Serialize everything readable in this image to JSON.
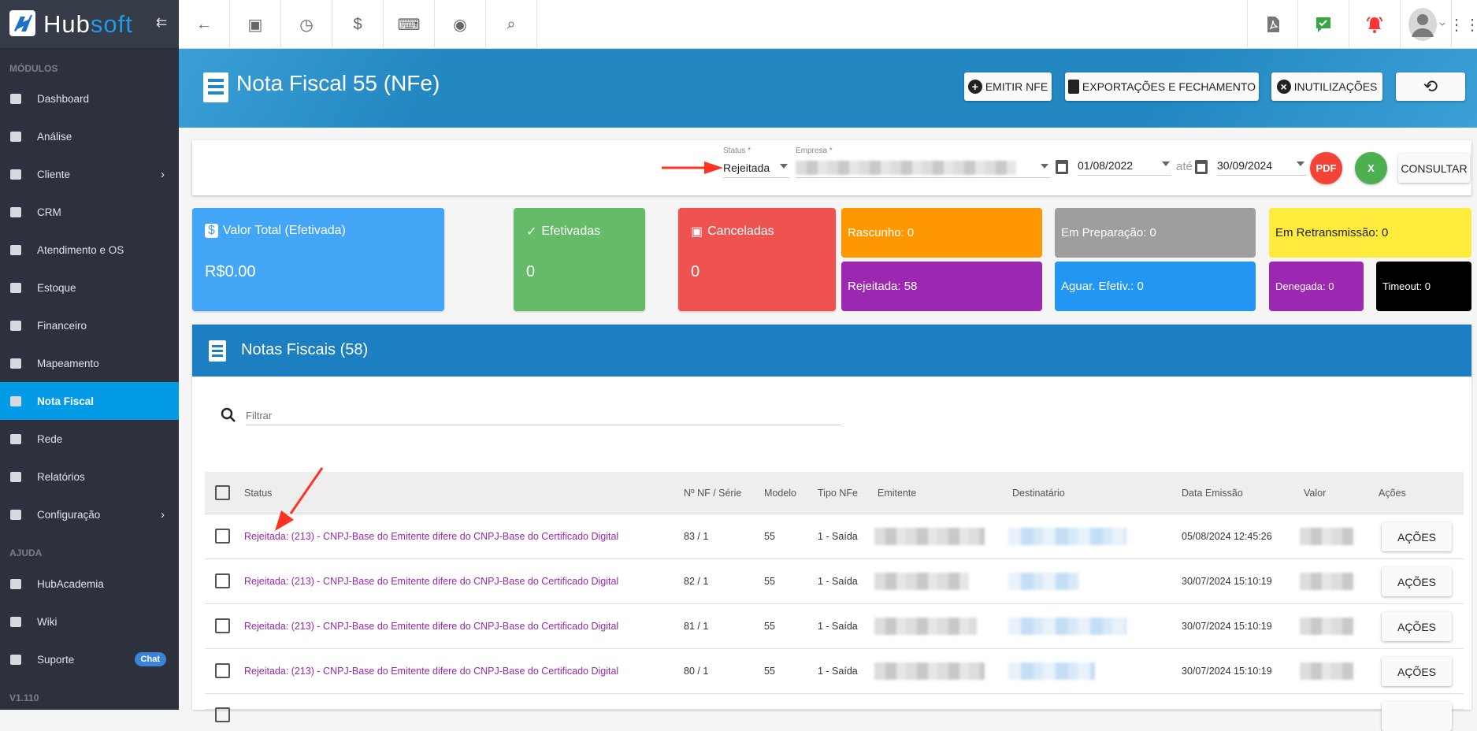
{
  "app": {
    "logo_text_a": "Hub",
    "logo_text_b": "soft",
    "version": "V1.110"
  },
  "sidebar": {
    "section_modules": "MÓDULOS",
    "section_help": "AJUDA",
    "items": [
      {
        "label": "Dashboard",
        "icon": "dashboard-icon"
      },
      {
        "label": "Análise",
        "icon": "pie-chart-icon"
      },
      {
        "label": "Cliente",
        "icon": "contact-icon",
        "chevron": true
      },
      {
        "label": "CRM",
        "icon": "trello-icon"
      },
      {
        "label": "Atendimento e OS",
        "icon": "calendar-clock-icon"
      },
      {
        "label": "Estoque",
        "icon": "box-icon"
      },
      {
        "label": "Financeiro",
        "icon": "money-icon"
      },
      {
        "label": "Mapeamento",
        "icon": "map-marker-icon"
      },
      {
        "label": "Nota Fiscal",
        "icon": "receipt-icon",
        "active": true
      },
      {
        "label": "Rede",
        "icon": "server-icon"
      },
      {
        "label": "Relatórios",
        "icon": "file-icon"
      },
      {
        "label": "Configuração",
        "icon": "gear-icon",
        "chevron": true
      }
    ],
    "help_items": [
      {
        "label": "HubAcademia",
        "icon": "youtube-icon"
      },
      {
        "label": "Wiki",
        "icon": "wikipedia-icon"
      },
      {
        "label": "Suporte",
        "icon": "message-icon",
        "badge": "Chat"
      }
    ]
  },
  "topbar": {
    "icons": [
      "arrow-left-icon",
      "contact-icon",
      "calendar-clock-icon",
      "dollar-icon",
      "terminal-icon",
      "eye-icon",
      "search-icon"
    ],
    "right_icons": [
      "pdf-icon",
      "chat-check-icon",
      "bell-icon",
      "avatar",
      "grid-icon"
    ]
  },
  "header": {
    "title": "Nota Fiscal 55 (NFe)",
    "buttons": {
      "emit": "EMITIR NFE",
      "export": "EXPORTAÇÕES E FECHAMENTO",
      "inutil": "INUTILIZAÇÕES"
    }
  },
  "filters": {
    "status_label": "Status *",
    "status_value": "Rejeitada",
    "empresa_label": "Empresa *",
    "date_from": "01/08/2022",
    "until": "até",
    "date_to": "30/09/2024",
    "consult": "CONSULTAR"
  },
  "stats": {
    "valor_label": "Valor Total (Efetivada)",
    "valor": "R$0.00",
    "efetivadas_label": "Efetivadas",
    "efetivadas": "0",
    "canceladas_label": "Canceladas",
    "canceladas": "0",
    "rascunho": "Rascunho: 0",
    "rejeitada": "Rejeitada: 58",
    "preparacao": "Em Preparação: 0",
    "aguar": "Aguar. Efetiv.: 0",
    "retransmissao": "Em Retransmissão: 0",
    "denegada": "Denegada: 0",
    "timeout": "Timeout: 0"
  },
  "colors": {
    "sidebar": "#2d313d",
    "active": "#039be5",
    "valor": "#42a5f5",
    "efetivadas": "#66bb6a",
    "canceladas": "#ef5350",
    "rascunho": "#ff9800",
    "rejeitada": "#9c27b0",
    "preparacao": "#9e9e9e",
    "aguar": "#2196f3",
    "retransmissao": "#ffeb3b",
    "timeout": "#000000"
  },
  "list": {
    "title": "Notas Fiscais (58)",
    "filter_placeholder": "Filtrar",
    "columns": [
      "Status",
      "Nº NF / Série",
      "Modelo",
      "Tipo NFe",
      "Emitente",
      "Destinatário",
      "Data Emissão",
      "Valor",
      "Ações"
    ],
    "rows": [
      {
        "status": "Rejeitada: (213) - CNPJ-Base do Emitente difere do CNPJ-Base do Certificado Digital",
        "nf": "83 / 1",
        "modelo": "55",
        "tipo": "1 - Saída",
        "data": "05/08/2024 12:45:26",
        "acao": "AÇÕES"
      },
      {
        "status": "Rejeitada: (213) - CNPJ-Base do Emitente difere do CNPJ-Base do Certificado Digital",
        "nf": "82 / 1",
        "modelo": "55",
        "tipo": "1 - Saída",
        "data": "30/07/2024 15:10:19",
        "acao": "AÇÕES"
      },
      {
        "status": "Rejeitada: (213) - CNPJ-Base do Emitente difere do CNPJ-Base do Certificado Digital",
        "nf": "81 / 1",
        "modelo": "55",
        "tipo": "1 - Saída",
        "data": "30/07/2024 15:10:19",
        "acao": "AÇÕES"
      },
      {
        "status": "Rejeitada: (213) - CNPJ-Base do Emitente difere do CNPJ-Base do Certificado Digital",
        "nf": "80 / 1",
        "modelo": "55",
        "tipo": "1 - Saída",
        "data": "30/07/2024 15:10:19",
        "acao": "AÇÕES"
      }
    ]
  }
}
